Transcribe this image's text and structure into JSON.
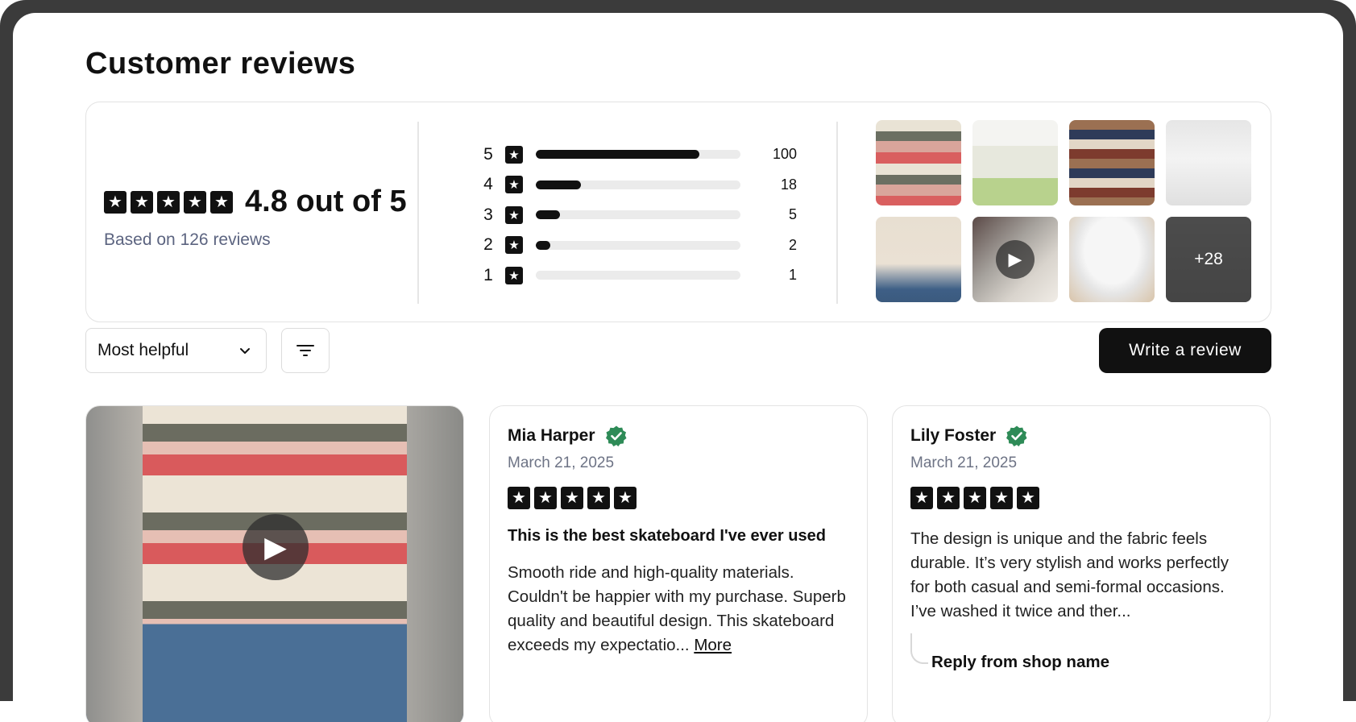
{
  "page": {
    "title": "Customer reviews"
  },
  "summary": {
    "average_label": "4.8 out of 5",
    "average": 4.8,
    "based_on": "Based on 126 reviews",
    "distribution": [
      {
        "stars": "5",
        "count": "100",
        "fraction": 0.8
      },
      {
        "stars": "4",
        "count": "18",
        "fraction": 0.22
      },
      {
        "stars": "3",
        "count": "5",
        "fraction": 0.12
      },
      {
        "stars": "2",
        "count": "2",
        "fraction": 0.07
      },
      {
        "stars": "1",
        "count": "1",
        "fraction": 0.0
      }
    ],
    "media_thumbnails": [
      {
        "name": "striped-sweater-photo",
        "type": "image"
      },
      {
        "name": "cream-sweater-back-photo",
        "type": "image"
      },
      {
        "name": "brown-navy-striped-sweater-photo",
        "type": "image"
      },
      {
        "name": "white-sweatshirt-photo",
        "type": "image"
      },
      {
        "name": "beige-knit-sweater-photo",
        "type": "image"
      },
      {
        "name": "boots-video",
        "type": "video"
      },
      {
        "name": "white-tshirt-photo",
        "type": "image"
      },
      {
        "name": "sneaker-photo",
        "type": "image",
        "more_label": "+28"
      }
    ]
  },
  "controls": {
    "sort_value": "Most helpful",
    "write_review_label": "Write a review"
  },
  "reviews": [
    {
      "author": "Mia Harper",
      "date": "March 21, 2025",
      "rating": 5,
      "title": "This is the best skateboard I've ever used",
      "body": "Smooth ride and high-quality materials. Couldn't be happier with my purchase. Superb quality and beautiful design. This skateboard exceeds my expectatio...",
      "more_label": "More"
    },
    {
      "author": "Lily Foster",
      "date": "March 21, 2025",
      "rating": 5,
      "body": "The design is unique and the fabric feels durable. It’s very stylish and works perfectly for both casual and semi-formal occasions. I’ve washed it twice and ther...",
      "reply_label": "Reply from shop name"
    }
  ],
  "colors": {
    "primary": "#111111",
    "muted_text": "#5c6480",
    "verified_green": "#2e8b57",
    "border": "#e3e3e3",
    "bar_track": "#ebebeb"
  },
  "icons": {
    "star": "star-icon",
    "verified": "verified-badge-icon",
    "play": "play-icon",
    "chevron": "chevron-down-icon",
    "filter": "filter-icon"
  }
}
